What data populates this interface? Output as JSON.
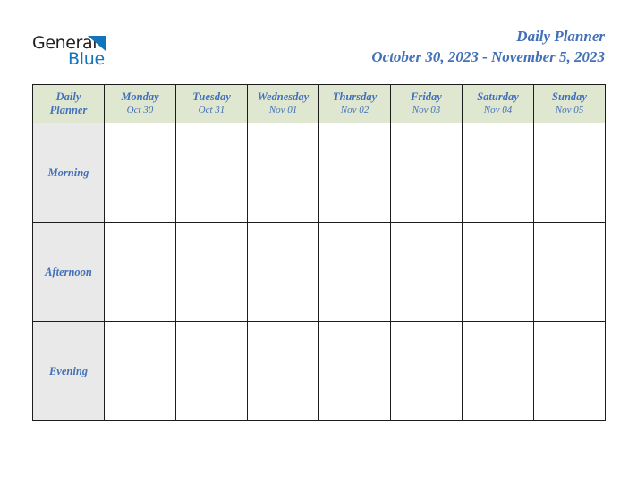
{
  "brand": {
    "name_part1": "General",
    "name_part2": "Blue",
    "triangle_color": "#1274bc",
    "text_color": "#231f20"
  },
  "header": {
    "title": "Daily Planner",
    "subtitle": "October 30, 2023 - November 5, 2023",
    "title_color": "#4371b8"
  },
  "colors": {
    "header_row_bg": "#dfe7d1",
    "period_label_bg": "#e9e9e9",
    "cell_bg": "#ffffff",
    "border": "#1c1c1c",
    "accent_text": "#4371b8"
  },
  "table": {
    "corner_label_line1": "Daily",
    "corner_label_line2": "Planner",
    "days": [
      {
        "name": "Monday",
        "date": "Oct 30"
      },
      {
        "name": "Tuesday",
        "date": "Oct 31"
      },
      {
        "name": "Wednesday",
        "date": "Nov 01"
      },
      {
        "name": "Thursday",
        "date": "Nov 02"
      },
      {
        "name": "Friday",
        "date": "Nov 03"
      },
      {
        "name": "Saturday",
        "date": "Nov 04"
      },
      {
        "name": "Sunday",
        "date": "Nov 05"
      }
    ],
    "periods": [
      {
        "label": "Morning",
        "entries": [
          "",
          "",
          "",
          "",
          "",
          "",
          ""
        ]
      },
      {
        "label": "Afternoon",
        "entries": [
          "",
          "",
          "",
          "",
          "",
          "",
          ""
        ]
      },
      {
        "label": "Evening",
        "entries": [
          "",
          "",
          "",
          "",
          "",
          "",
          ""
        ]
      }
    ]
  }
}
